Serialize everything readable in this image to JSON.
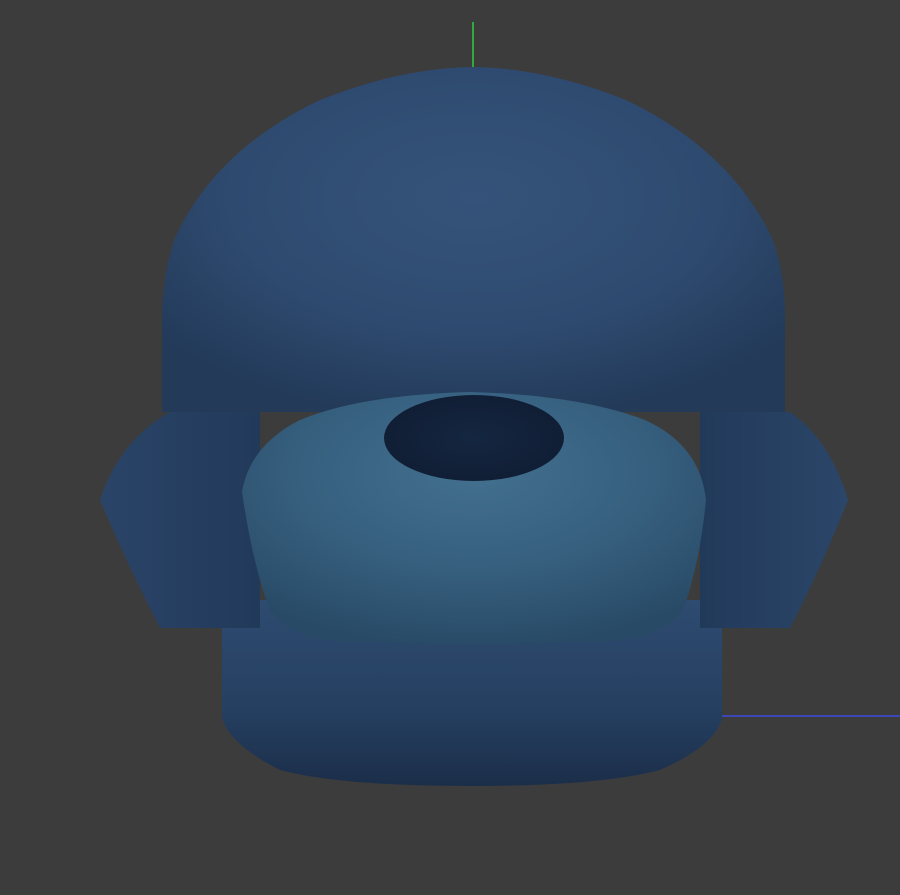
{
  "viewport": {
    "background": "#3c3c3c",
    "axes": {
      "y_axis_color": "#2ecc40",
      "x_axis_color": "#3a4bdc"
    },
    "model": {
      "name": "",
      "colors": {
        "base": "#2d4a6e",
        "highlight": "#3f6a8a",
        "shadow": "#1a2a40",
        "hole": "#13223a"
      }
    }
  }
}
